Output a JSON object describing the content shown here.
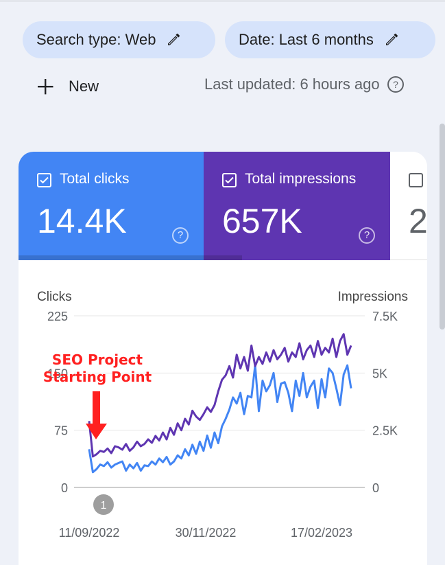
{
  "filters": {
    "search_type": "Search type: Web",
    "date": "Date: Last 6 months"
  },
  "toolbar": {
    "new_label": "New",
    "last_updated": "Last updated: 6 hours ago"
  },
  "metrics": {
    "clicks": {
      "label": "Total clicks",
      "value": "14.4K",
      "color": "#4285f4",
      "checked": true
    },
    "impressions": {
      "label": "Total impressions",
      "value": "657K",
      "color": "#5e35b1",
      "checked": true
    },
    "ctr": {
      "label": "",
      "value": "2",
      "checked": false
    }
  },
  "annotation": {
    "line1": "SEO Project",
    "line2": "Starting Point",
    "marker": "1",
    "color": "#ff2020"
  },
  "chart_data": {
    "type": "line",
    "ylabel_left": "Clicks",
    "ylabel_right": "Impressions",
    "y_left_ticks": [
      "225",
      "150",
      "75",
      "0"
    ],
    "y_right_ticks": [
      "7.5K",
      "5K",
      "2.5K",
      "0"
    ],
    "ylim_left": [
      0,
      225
    ],
    "ylim_right": [
      0,
      7500
    ],
    "x_tick_labels": [
      "11/09/2022",
      "30/11/2022",
      "17/02/2023"
    ],
    "grid": true,
    "series": [
      {
        "name": "Clicks",
        "axis": "left",
        "color": "#4285f4",
        "values": [
          50,
          20,
          24,
          30,
          28,
          33,
          26,
          30,
          32,
          34,
          22,
          30,
          25,
          32,
          22,
          29,
          28,
          34,
          30,
          38,
          33,
          40,
          30,
          34,
          42,
          38,
          50,
          42,
          56,
          44,
          60,
          48,
          68,
          52,
          72,
          58,
          80,
          90,
          102,
          118,
          110,
          124,
          96,
          120,
          118,
          160,
          100,
          140,
          126,
          134,
          150,
          112,
          136,
          138,
          124,
          100,
          140,
          120,
          150,
          118,
          132,
          140,
          104,
          142,
          118,
          156,
          150,
          130,
          108,
          148,
          160,
          130
        ]
      },
      {
        "name": "Impressions",
        "axis": "right",
        "color": "#5e35b1",
        "values": [
          2900,
          1350,
          1450,
          1600,
          1550,
          1700,
          1500,
          1800,
          1750,
          1650,
          1900,
          1600,
          1750,
          2000,
          1800,
          1900,
          2100,
          1950,
          2250,
          2050,
          2400,
          2100,
          2600,
          2300,
          2800,
          2500,
          3000,
          2750,
          3350,
          3100,
          2950,
          3200,
          3500,
          3300,
          3600,
          4200,
          4700,
          4900,
          5300,
          4800,
          5800,
          5200,
          5700,
          5100,
          6200,
          5300,
          5700,
          5400,
          5900,
          5500,
          6000,
          5600,
          5800,
          6100,
          5500,
          5900,
          5700,
          6300,
          5600,
          6000,
          6200,
          5700,
          6400,
          5800,
          6100,
          5900,
          6500,
          5700,
          6400,
          6700,
          5800,
          6200
        ]
      }
    ]
  }
}
